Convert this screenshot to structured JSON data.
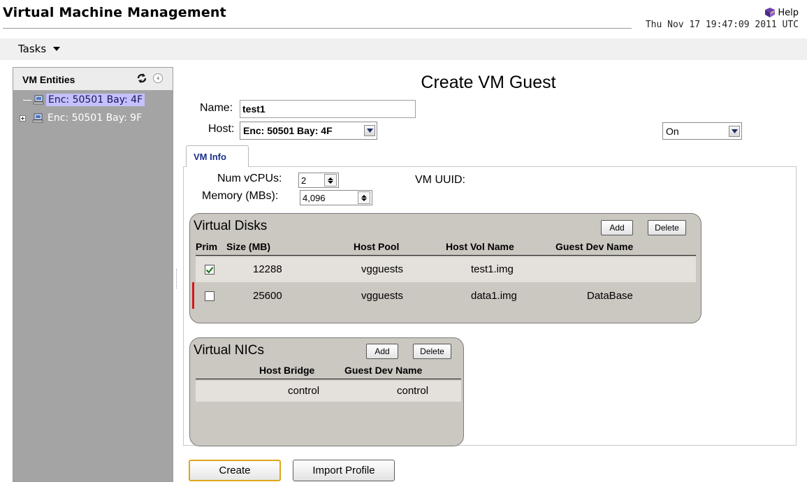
{
  "app": {
    "title": "Virtual Machine Management",
    "help_label": "Help",
    "timestamp": "Thu Nov 17 19:47:09 2011 UTC"
  },
  "menubar": {
    "tasks_label": "Tasks"
  },
  "sidebar": {
    "title": "VM Entities",
    "items": [
      {
        "label": "Enc: 50501 Bay: 4F",
        "selected": true
      },
      {
        "label": "Enc: 50501 Bay: 9F",
        "selected": false
      }
    ]
  },
  "form": {
    "page_title": "Create VM Guest",
    "name_label": "Name:",
    "name_value": "test1",
    "host_label": "Host:",
    "host_value": "Enc: 50501  Bay: 4F",
    "power_value": "On"
  },
  "tabs": {
    "vminfo_label": "VM Info"
  },
  "vm_info": {
    "vcpus_label": "Num vCPUs:",
    "vcpus_value": "2",
    "memory_label": "Memory (MBs):",
    "memory_value": "4,096",
    "uuid_label": "VM UUID:"
  },
  "disks": {
    "title": "Virtual Disks",
    "add_label": "Add",
    "delete_label": "Delete",
    "headers": [
      "Prim",
      "Size (MB)",
      "Host Pool",
      "Host Vol Name",
      "Guest Dev Name"
    ],
    "rows": [
      {
        "prim": true,
        "size": "12288",
        "pool": "vgguests",
        "vol": "test1.img",
        "guest_dev": ""
      },
      {
        "prim": false,
        "size": "25600",
        "pool": "vgguests",
        "vol": "data1.img",
        "guest_dev": "DataBase"
      }
    ]
  },
  "nics": {
    "title": "Virtual NICs",
    "add_label": "Add",
    "delete_label": "Delete",
    "headers": [
      "Host Bridge",
      "Guest Dev Name"
    ],
    "rows": [
      {
        "bridge": "control",
        "guest_dev": "control"
      }
    ]
  },
  "footer": {
    "create_label": "Create",
    "import_label": "Import Profile"
  },
  "colors": {
    "accent_text": "#1a2f8a",
    "selection": "#c5c0ff",
    "groupbox_bg": "#cbc7c1",
    "create_border": "#e0a51a",
    "marker_red": "#d31a1a"
  },
  "icons": [
    "help-book-icon",
    "chevron-down-icon",
    "refresh-icon",
    "collapse-left-icon",
    "computer-icon",
    "expand-plus-icon",
    "checkmark-icon"
  ]
}
